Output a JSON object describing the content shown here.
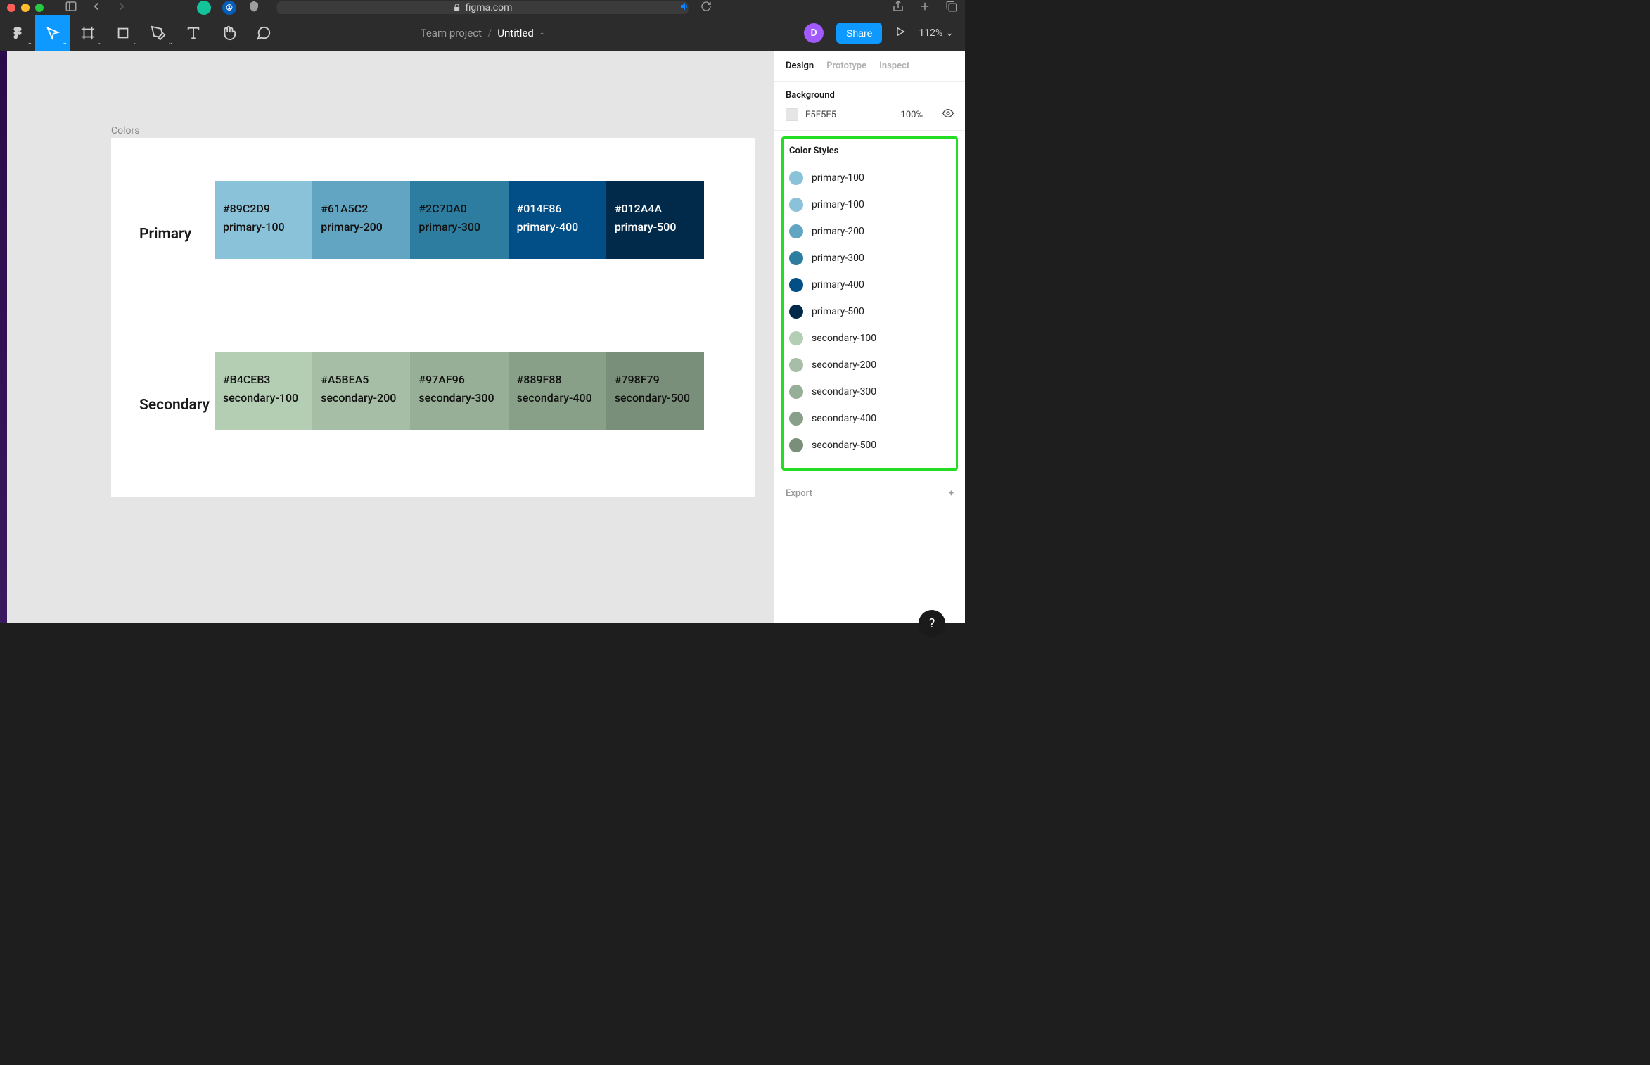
{
  "browser": {
    "url_host": "figma.com"
  },
  "toolbar": {
    "project": "Team project",
    "file": "Untitled",
    "avatar_initial": "D",
    "share_label": "Share",
    "zoom": "112%"
  },
  "canvas": {
    "frame_label": "Colors",
    "row1_title": "Primary",
    "row2_title": "Secondary",
    "primary": [
      {
        "hex": "#89C2D9",
        "name": "primary-100",
        "bg": "#89C2D9",
        "text": "dark"
      },
      {
        "hex": "#61A5C2",
        "name": "primary-200",
        "bg": "#61A5C2",
        "text": "dark"
      },
      {
        "hex": "#2C7DA0",
        "name": "primary-300",
        "bg": "#2C7DA0",
        "text": "dark"
      },
      {
        "hex": "#014F86",
        "name": "primary-400",
        "bg": "#014F86",
        "text": "light"
      },
      {
        "hex": "#012A4A",
        "name": "primary-500",
        "bg": "#012A4A",
        "text": "light"
      }
    ],
    "secondary": [
      {
        "hex": "#B4CEB3",
        "name": "secondary-100",
        "bg": "#B4CEB3",
        "text": "dark"
      },
      {
        "hex": "#A5BEA5",
        "name": "secondary-200",
        "bg": "#A5BEA5",
        "text": "dark"
      },
      {
        "hex": "#97AF96",
        "name": "secondary-300",
        "bg": "#97AF96",
        "text": "dark"
      },
      {
        "hex": "#889F88",
        "name": "secondary-400",
        "bg": "#889F88",
        "text": "dark"
      },
      {
        "hex": "#798F79",
        "name": "secondary-500",
        "bg": "#798F79",
        "text": "dark"
      }
    ]
  },
  "panel": {
    "tabs": {
      "design": "Design",
      "prototype": "Prototype",
      "inspect": "Inspect"
    },
    "background_label": "Background",
    "background_hex": "E5E5E5",
    "background_opacity": "100%",
    "color_styles_label": "Color Styles",
    "styles": [
      {
        "name": "primary-100",
        "color": "#89C2D9"
      },
      {
        "name": "primary-100",
        "color": "#89C2D9"
      },
      {
        "name": "primary-200",
        "color": "#61A5C2"
      },
      {
        "name": "primary-300",
        "color": "#2C7DA0"
      },
      {
        "name": "primary-400",
        "color": "#014F86"
      },
      {
        "name": "primary-500",
        "color": "#012A4A"
      },
      {
        "name": "secondary-100",
        "color": "#B4CEB3"
      },
      {
        "name": "secondary-200",
        "color": "#A5BEA5"
      },
      {
        "name": "secondary-300",
        "color": "#97AF96"
      },
      {
        "name": "secondary-400",
        "color": "#889F88"
      },
      {
        "name": "secondary-500",
        "color": "#798F79"
      }
    ],
    "export_label": "Export"
  }
}
